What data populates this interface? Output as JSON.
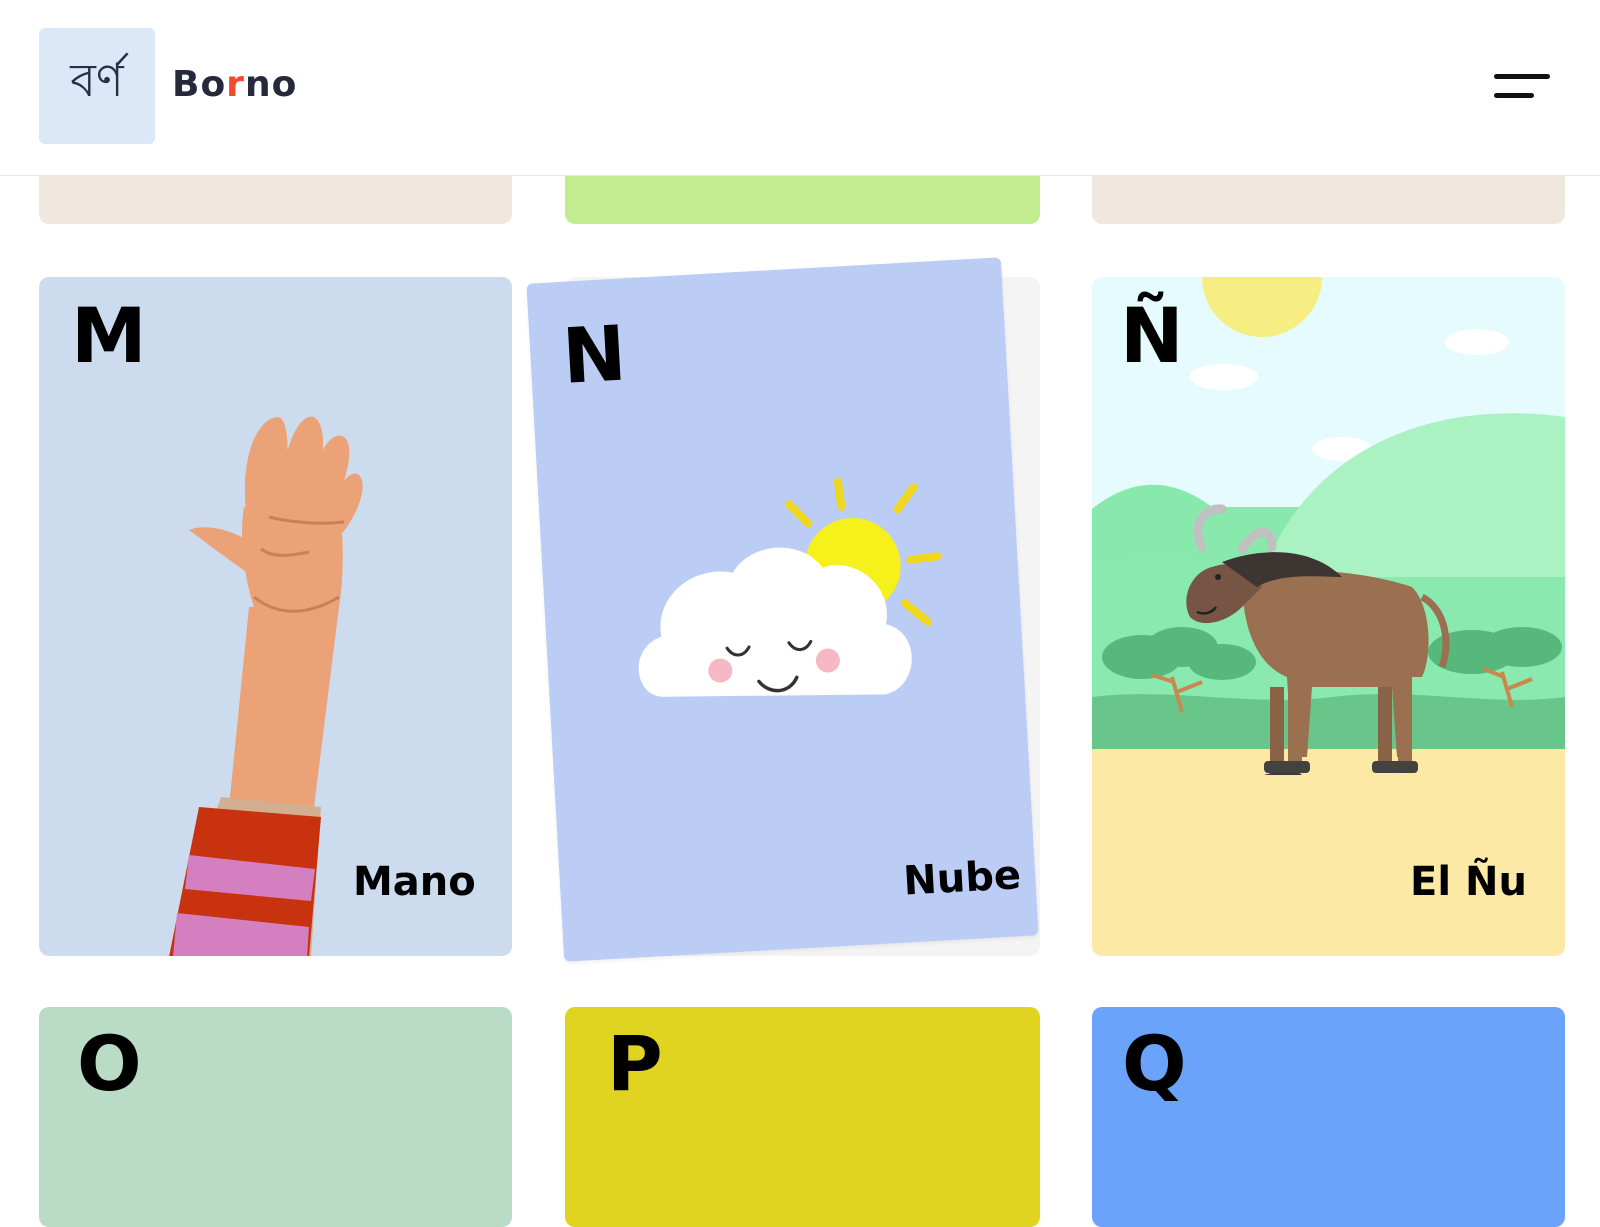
{
  "header": {
    "logo_glyph": "বর্ণ",
    "brand_prefix": "Bo",
    "brand_accent": "r",
    "brand_suffix": "no",
    "menu_icon": "hamburger-menu-icon"
  },
  "cards": [
    {
      "letter": "M",
      "word": "Mano",
      "color": "#ccdcee",
      "icon": "hand-illustration"
    },
    {
      "letter": "N",
      "word": "Nube",
      "color": "#bbcdf5",
      "icon": "cloud-sun-illustration"
    },
    {
      "letter": "Ñ",
      "word": "El Ñu",
      "color": "#e5fbfd",
      "icon": "wildebeest-illustration"
    },
    {
      "letter": "O",
      "color": "#badcc6"
    },
    {
      "letter": "P",
      "color": "#e0d421"
    },
    {
      "letter": "Q",
      "color": "#6ba3fb"
    }
  ],
  "colors": {
    "accent": "#ef4b2c",
    "logo_bg": "#dbe8f7",
    "previous_row": [
      "#f0e8de",
      "#c2ec8f",
      "#f0e8de"
    ]
  }
}
